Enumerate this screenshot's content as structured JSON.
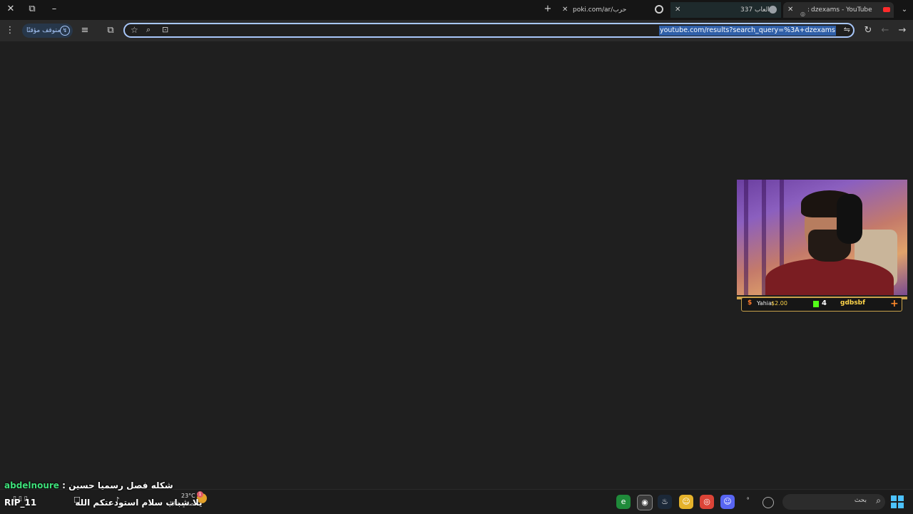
{
  "browser": {
    "tabs": [
      {
        "title": "dzexams - YouTube",
        "prefix": ":",
        "active": true
      },
      {
        "title": "العاب 337",
        "active": false
      },
      {
        "title": "poki.com/ar/حرب",
        "active": false
      }
    ],
    "new_tab_symbol": "+",
    "paused_label": "متوقف مؤقتًا",
    "url": "youtube.com/results?search_query=%3A+dzexams"
  },
  "stream_overlay": {
    "donor_name": "Yahia:",
    "donor_amount": "$2.00",
    "kick_count": "4",
    "username": "gdbsbf"
  },
  "chat": {
    "user": "abdelnoure",
    "separator": " : ",
    "message": "شكله فصل رسميا حسين",
    "second_line": "يلا شباب سلام استودعتكم الله",
    "second_prefix": "RIP_11"
  },
  "taskbar": {
    "weather_temp": "23°C",
    "weather_desc": "صافٍ غالبًا",
    "weather_badge": "1",
    "search_placeholder": "بحث",
    "apps": [
      "edge",
      "chrome-canary",
      "steam",
      "discord-yellow",
      "chrome",
      "discord",
      "terminal",
      "settings"
    ]
  },
  "colors": {
    "accent": "#a8c7fa",
    "url_highlight": "#2f5fa8",
    "chat_user": "#3ee07a",
    "kick_green": "#53fc18"
  }
}
